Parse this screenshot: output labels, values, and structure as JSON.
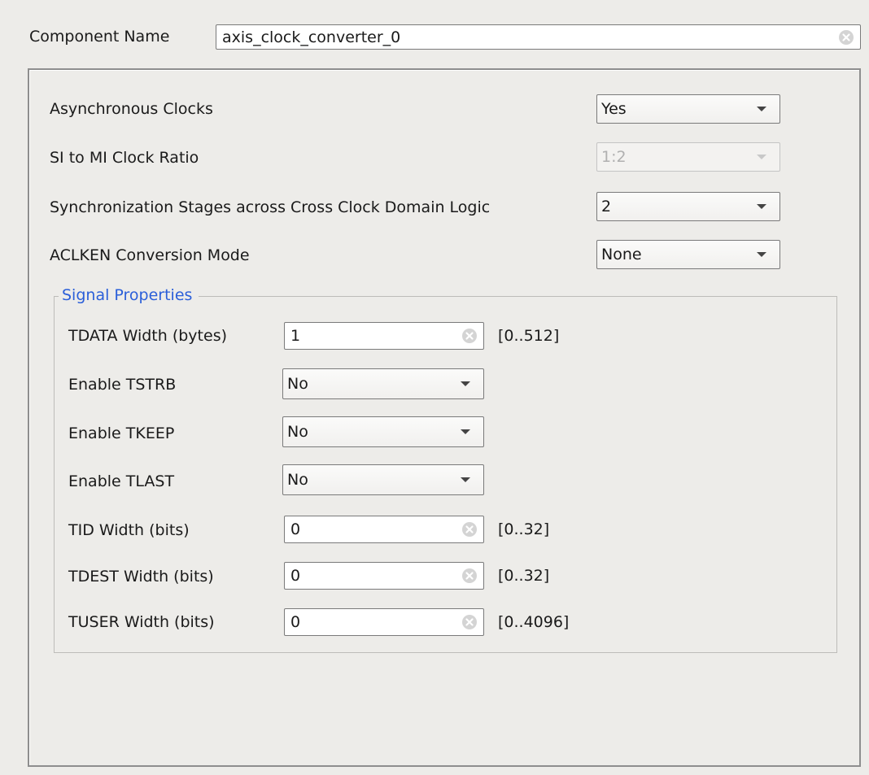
{
  "component": {
    "label": "Component Name",
    "value": "axis_clock_converter_0"
  },
  "settings": [
    {
      "label": "Asynchronous Clocks",
      "value": "Yes",
      "enabled": true
    },
    {
      "label": "SI to MI Clock Ratio",
      "value": "1:2",
      "enabled": false
    },
    {
      "label": "Synchronization Stages across Cross Clock Domain Logic",
      "value": "2",
      "enabled": true
    },
    {
      "label": "ACLKEN Conversion Mode",
      "value": "None",
      "enabled": true
    }
  ],
  "signal_properties": {
    "title": "Signal Properties",
    "tdata": {
      "label": "TDATA Width (bytes)",
      "value": "1",
      "range": "[0..512]"
    },
    "tstrb": {
      "label": "Enable TSTRB",
      "value": "No"
    },
    "tkeep": {
      "label": "Enable TKEEP",
      "value": "No"
    },
    "tlast": {
      "label": "Enable TLAST",
      "value": "No"
    },
    "tid": {
      "label": "TID Width (bits)",
      "value": "0",
      "range": "[0..32]"
    },
    "tdest": {
      "label": "TDEST Width (bits)",
      "value": "0",
      "range": "[0..32]"
    },
    "tuser": {
      "label": "TUSER Width (bits)",
      "value": "0",
      "range": "[0..4096]"
    }
  },
  "colors": {
    "background": "#edece9",
    "group_title": "#2b5fd9",
    "disabled_text": "#b0b0b0"
  },
  "icons": {
    "clear": "clear-circle-icon",
    "dropdown": "chevron-down-icon"
  }
}
